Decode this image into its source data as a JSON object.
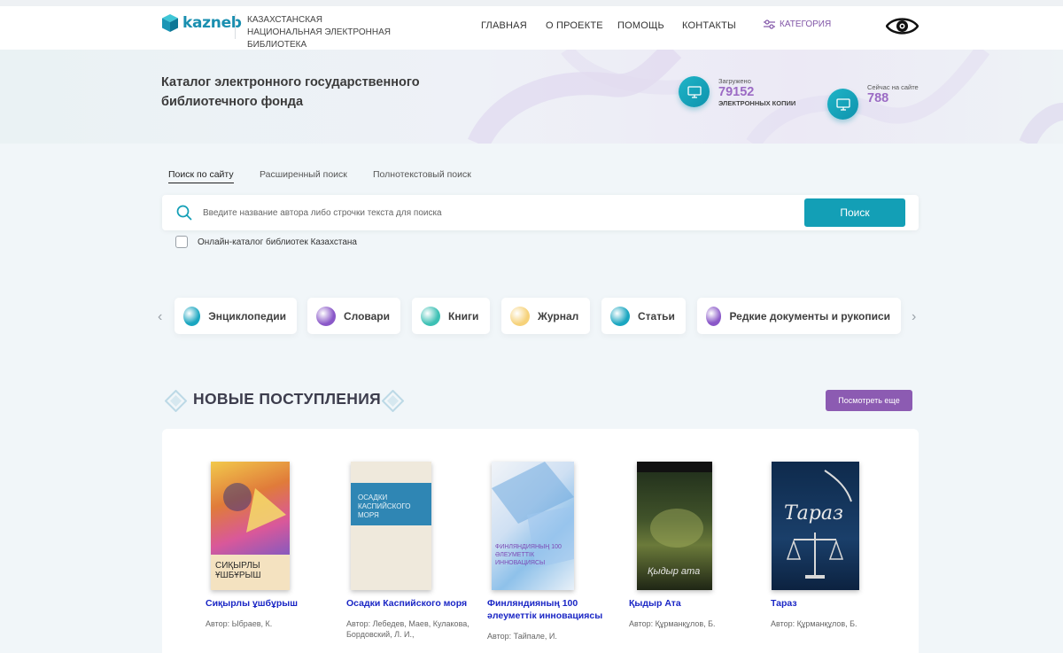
{
  "header": {
    "logo_text": "kazneb",
    "logo_subtitle": "КАЗАХСТАНСКАЯ НАЦИОНАЛЬНАЯ ЭЛЕКТРОННАЯ БИБЛИОТЕКА",
    "nav": [
      "ГЛАВНАЯ",
      "О ПРОЕКТЕ",
      "ПОМОЩЬ",
      "КОНТАКТЫ"
    ],
    "category_label": "КАТЕГОРИЯ",
    "accessibility_icon": "eye-icon"
  },
  "hero": {
    "title": "Каталог электронного государственного библиотечного фонда",
    "stat_uploaded": {
      "label": "Загружено",
      "value": "79152",
      "sub": "ЭЛЕКТРОННЫХ КОПИИ"
    },
    "stat_online": {
      "label": "Сейчас на сайте",
      "value": "788"
    }
  },
  "search": {
    "tabs": [
      "Поиск по сайту",
      "Расширенный поиск",
      "Полнотекстовый поиск"
    ],
    "active_tab": 0,
    "placeholder": "Введите название автора либо строчки текста для поиска",
    "button": "Поиск",
    "checkbox_label": "Онлайн-каталог библиотек Казахстана",
    "checkbox_checked": false
  },
  "categories": [
    {
      "label": "Энциклопедии",
      "color": "#1aa6c0"
    },
    {
      "label": "Словари",
      "color": "#8a58c8"
    },
    {
      "label": "Книги",
      "color": "#3cc0b4"
    },
    {
      "label": "Журнал",
      "color": "#f6d27a"
    },
    {
      "label": "Статьи",
      "color": "#1aa6c0"
    },
    {
      "label": "Редкие документы и рукописи",
      "color": "#8a58c8"
    }
  ],
  "new_arrivals": {
    "title": "НОВЫЕ ПОСТУПЛЕНИЯ",
    "more_button": "Посмотреть еще",
    "books": [
      {
        "title": "Сиқырлы ұшбұрыш",
        "author": "Автор: Ыбраев, К.",
        "cover_text": "СИҚЫРЛЫ ҰШБҰРЫШ"
      },
      {
        "title": "Осадки Каспийского моря",
        "author": "Автор: Лебедев, Маев, Кулакова, Бордовский, Л. И.,",
        "cover_text": "ОСАДКИ КАСПИЙСКОГО МОРЯ"
      },
      {
        "title": "Финляндияның 100 әлеуметтік инновациясы",
        "author": "Автор: Тайпале, И.",
        "cover_text": "ФИНЛЯНДИЯНЫҢ 100 ӘЛЕУМЕТТІК ИННОВАЦИЯСЫ"
      },
      {
        "title": "Қыдыр Ата",
        "author": "Автор: Құрманқұлов, Б.",
        "cover_text": "Қыдыр ата"
      },
      {
        "title": "Тараз",
        "author": "Автор: Құрманқұлов, Б.",
        "cover_text": "Тараз"
      }
    ]
  }
}
